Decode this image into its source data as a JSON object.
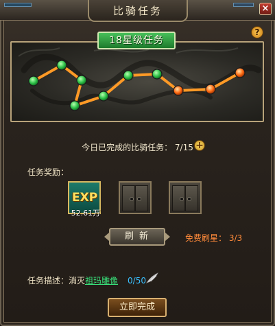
{
  "window": {
    "title": "比骑任务",
    "close_label": "×"
  },
  "help_label": "?",
  "star_tab": {
    "label": "18星级任务"
  },
  "path": {
    "total_nodes": 10,
    "completed_nodes": 7
  },
  "daily": {
    "text": "今日已完成的比骑任务： 7/15",
    "add_label": "+"
  },
  "rewards": {
    "label": "任务奖励：",
    "items": [
      {
        "name": "EXP",
        "amount": "52.61万",
        "locked": false
      },
      {
        "locked": true
      },
      {
        "locked": true
      }
    ]
  },
  "refresh": {
    "label": "刷新",
    "free_text": "免费刷星： 3/3"
  },
  "task": {
    "prefix": "任务描述：消灭",
    "target": "祖玛雕像",
    "progress": "0/50"
  },
  "complete_button": "立即完成",
  "colors": {
    "node_done": "#2fc24a",
    "node_pending": "#ff6a12",
    "path_line": "#ff9a26"
  }
}
